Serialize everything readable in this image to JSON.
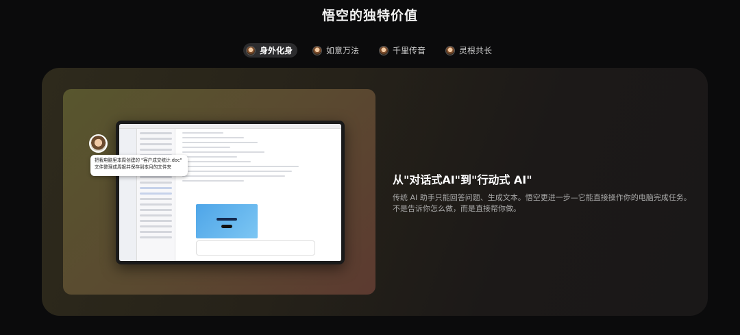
{
  "section_title": "悟空的独特价值",
  "tabs": [
    {
      "label": "身外化身",
      "active": true
    },
    {
      "label": "如意万法",
      "active": false
    },
    {
      "label": "千里传音",
      "active": false
    },
    {
      "label": "灵根共长",
      "active": false
    }
  ],
  "feature": {
    "headline": "从\"对话式AI\"到\"行动式 AI\"",
    "description": "传统 AI 助手只能回答问题、生成文本。悟空更进一步—它能直接操作你的电脑完成任务。不是告诉你怎么做，而是直接帮你做。"
  },
  "screenshot": {
    "bubble_line1": "把我电脑里本周创建的 \"客户成交统计.doc\"",
    "bubble_line2": "文件整理成周报并保存到本月的文件夹"
  }
}
